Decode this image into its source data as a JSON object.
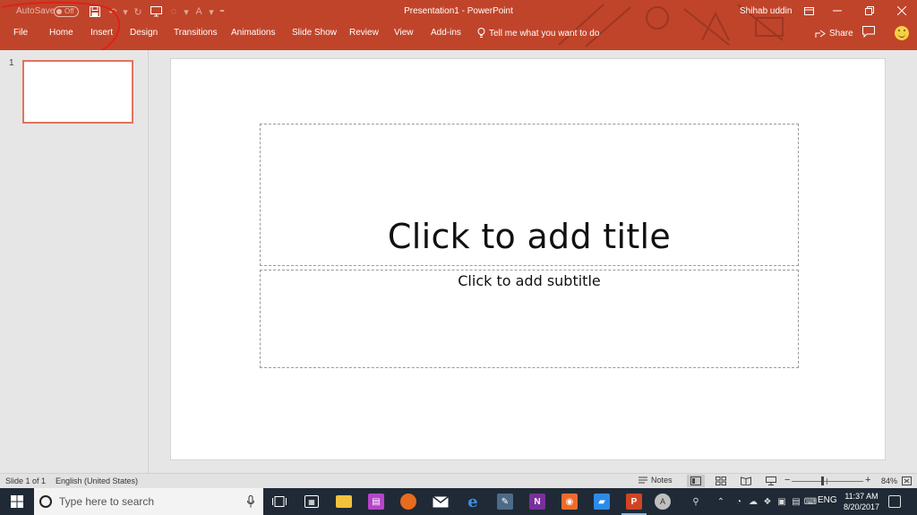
{
  "titlebar": {
    "autosave_label": "AutoSave",
    "autosave_state": "Off",
    "document_title": "Presentation1  -  PowerPoint",
    "user_name": "Shihab uddin"
  },
  "ribbon": {
    "tabs": [
      {
        "label": "File"
      },
      {
        "label": "Home"
      },
      {
        "label": "Insert"
      },
      {
        "label": "Design"
      },
      {
        "label": "Transitions"
      },
      {
        "label": "Animations"
      },
      {
        "label": "Slide Show"
      },
      {
        "label": "Review"
      },
      {
        "label": "View"
      },
      {
        "label": "Add-ins"
      }
    ],
    "tell_me": "Tell me what you want to do",
    "share_label": "Share"
  },
  "thumbnails": {
    "slide_number": "1"
  },
  "slide": {
    "title_placeholder": "Click to add title",
    "subtitle_placeholder": "Click to add subtitle"
  },
  "statusbar": {
    "slide_count": "Slide 1 of 1",
    "language": "English (United States)",
    "notes_label": "Notes",
    "zoom": "84%"
  },
  "taskbar": {
    "search_placeholder": "Type here to search",
    "avatar_letter": "A",
    "language": "ENG",
    "time": "11:37 AM",
    "date": "8/20/2017"
  },
  "colors": {
    "accent": "#c0442a",
    "taskbar": "#1f2a36"
  }
}
